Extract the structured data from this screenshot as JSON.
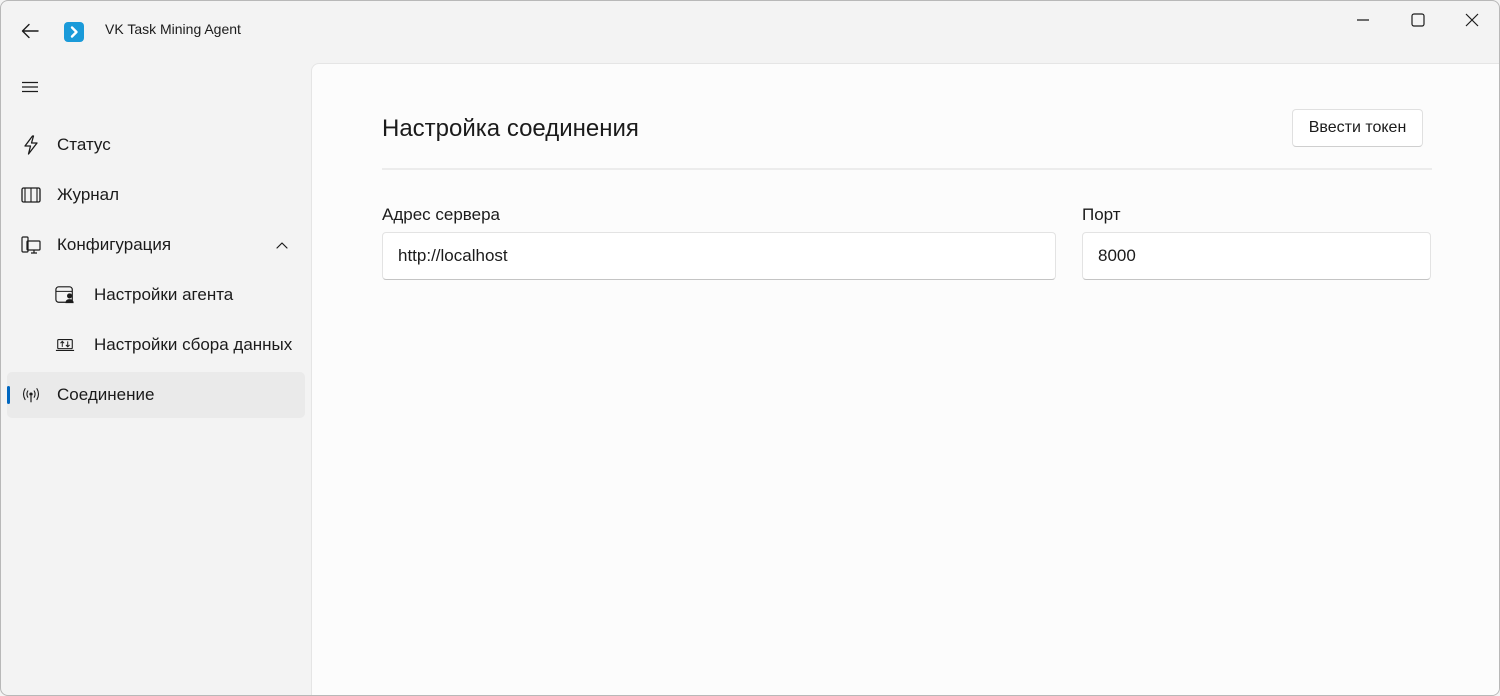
{
  "app": {
    "title": "VK Task Mining Agent"
  },
  "sidebar": {
    "items": [
      {
        "label": "Статус",
        "icon": "lightning-icon"
      },
      {
        "label": "Журнал",
        "icon": "book-icon"
      },
      {
        "label": "Конфигурация",
        "icon": "devices-icon",
        "expanded": true
      },
      {
        "label": "Настройки агента",
        "icon": "agent-settings-icon"
      },
      {
        "label": "Настройки сбора данных",
        "icon": "data-collection-icon"
      },
      {
        "label": "Соединение",
        "icon": "antenna-icon",
        "selected": true
      }
    ]
  },
  "main": {
    "title": "Настройка соединения",
    "token_button": "Ввести токен",
    "server": {
      "label": "Адрес сервера",
      "value": "http://localhost"
    },
    "port": {
      "label": "Порт",
      "value": "8000"
    }
  },
  "colors": {
    "accent": "#0067c0",
    "app_icon": "#1a9ad9"
  }
}
